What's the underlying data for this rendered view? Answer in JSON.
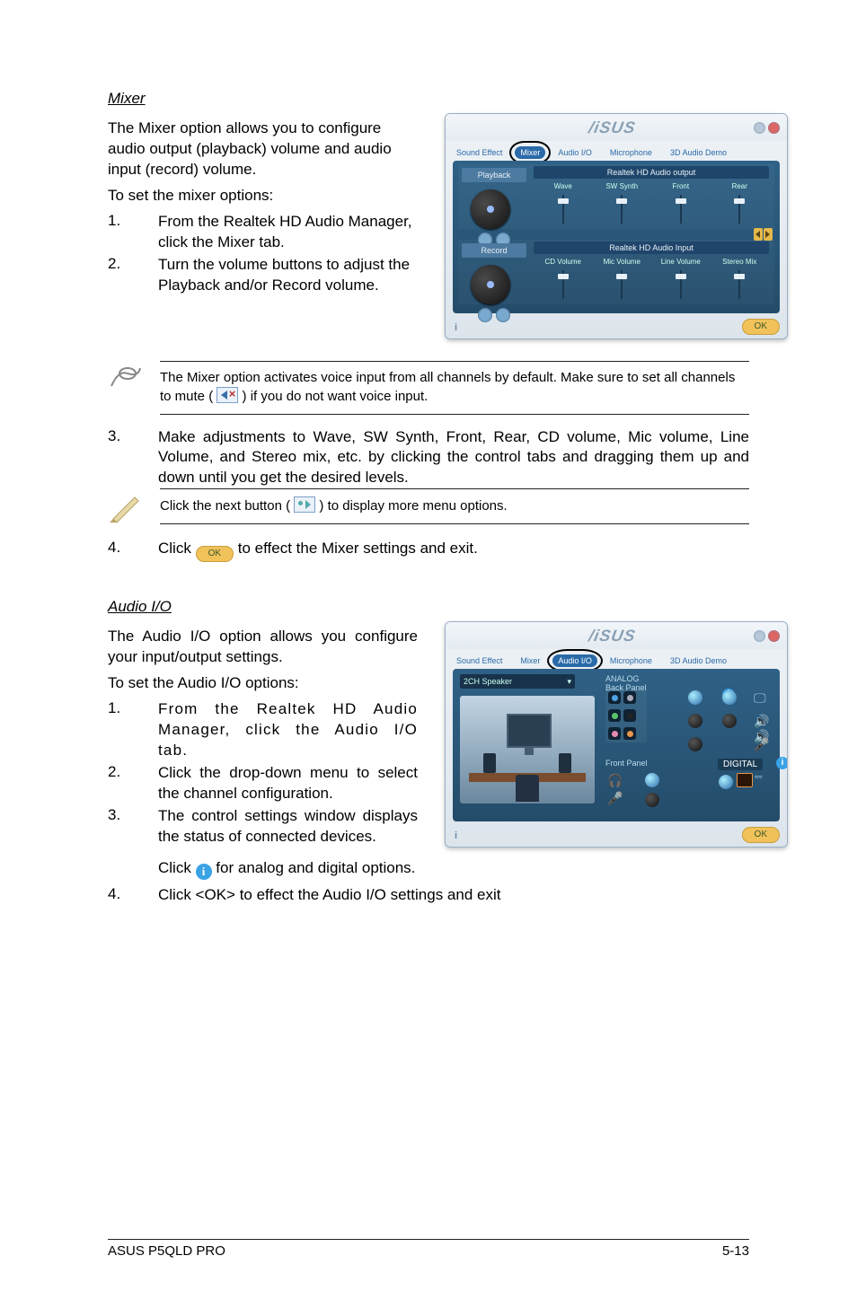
{
  "mixer": {
    "title": "Mixer",
    "intro": "The Mixer option allows you to configure audio output (playback) volume and audio input (record) volume.",
    "setline": "To set the mixer options:",
    "steps12": [
      "From the Realtek HD Audio Manager, click the Mixer tab.",
      "Turn the volume buttons to adjust the Playback and/or Record volume."
    ],
    "note1_a": "The Mixer option activates voice input from all channels by default. Make sure to set all channels to mute (",
    "note1_b": ") if you do not want voice input.",
    "step3": "Make adjustments to Wave, SW Synth, Front, Rear, CD volume, Mic volume, Line Volume, and Stereo mix, etc. by clicking the control tabs and dragging them up and down until you get the desired levels.",
    "note2_a": "Click the next button (",
    "note2_b": ") to display more menu options.",
    "step4_a": "Click ",
    "step4_b": " to effect the Mixer settings and exit.",
    "ok_label": "OK",
    "panel": {
      "logo": "/iSUS",
      "tabs": [
        "Sound Effect",
        "Mixer",
        "Audio I/O",
        "Microphone",
        "3D Audio Demo"
      ],
      "playback_label": "Playback",
      "record_label": "Record",
      "out_header": "Realtek HD Audio output",
      "in_header": "Realtek HD Audio Input",
      "out_cols": [
        "Wave",
        "SW Synth",
        "Front",
        "Rear"
      ],
      "in_cols": [
        "CD Volume",
        "Mic Volume",
        "Line Volume",
        "Stereo Mix"
      ]
    }
  },
  "audioio": {
    "title": "Audio I/O",
    "intro": "The Audio I/O option allows you configure your input/output settings.",
    "setline": "To set the Audio I/O options:",
    "steps": [
      "From the Realtek HD Audio Manager, click the Audio I/O tab.",
      "Click the drop-down menu to select the channel configuration.",
      "The control settings window displays the status of connected devices."
    ],
    "step3b_a": "Click ",
    "step3b_b": " for analog and digital options.",
    "step4": "Click <OK> to effect the Audio I/O settings and exit",
    "panel": {
      "logo": "/iSUS",
      "tabs": [
        "Sound Effect",
        "Mixer",
        "Audio I/O",
        "Microphone",
        "3D Audio Demo"
      ],
      "select": "2CH Speaker",
      "analog": "ANALOG",
      "back": "Back Panel",
      "front": "Front Panel",
      "digital": "DIGITAL",
      "ok": "OK"
    }
  },
  "footer": {
    "left": "ASUS P5QLD PRO",
    "right": "5-13"
  }
}
